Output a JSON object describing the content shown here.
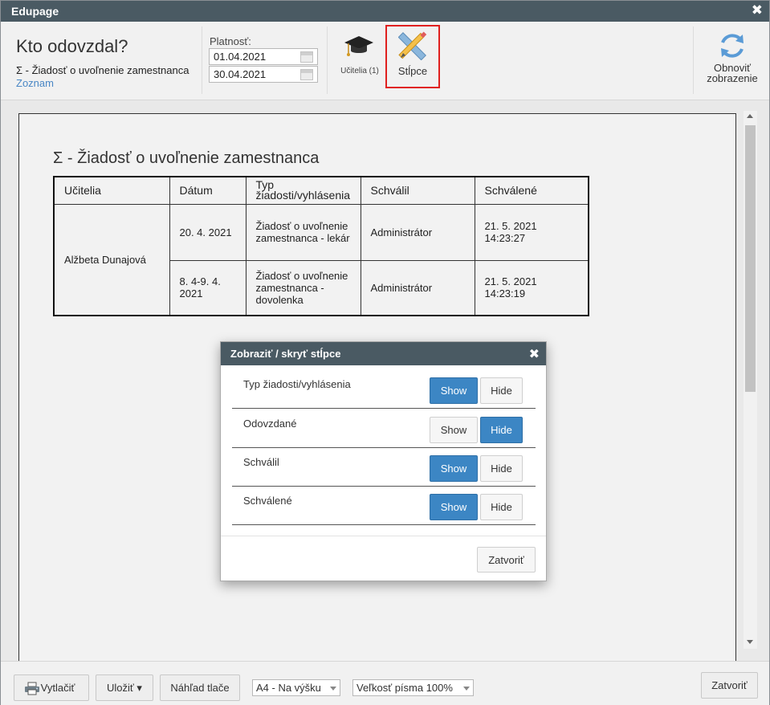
{
  "window": {
    "title": "Edupage",
    "close_glyph": "✖"
  },
  "header": {
    "title": "Kto odovzdal?",
    "subtitle": "Σ - Žiadosť o uvoľnenie zamestnanca",
    "link": "Zoznam",
    "validity_label": "Platnosť:",
    "date_from": "01.04.2021",
    "date_to": "30.04.2021",
    "teachers_label": "Učitelia (1)",
    "columns_label": "Stĺpce",
    "refresh_label_1": "Obnoviť",
    "refresh_label_2": "zobrazenie"
  },
  "report": {
    "title": "Σ - Žiadosť o uvoľnenie zamestnanca",
    "headers": [
      "Učitelia",
      "Dátum",
      "Typ žiadosti/vyhlásenia",
      "Schválil",
      "Schválené"
    ],
    "header_type_line1": "Typ",
    "header_type_line2": "žiadosti/vyhlásenia",
    "teacher": "Alžbeta Dunajová",
    "rows": [
      {
        "date": "20. 4. 2021",
        "type": "Žiadosť o uvoľnenie zamestnanca - lekár",
        "approver": "Administrátor",
        "approved": "21. 5. 2021 14:23:27"
      },
      {
        "date": "8. 4-9. 4. 2021",
        "type": "Žiadosť o uvoľnenie zamestnanca - dovolenka",
        "approver": "Administrátor",
        "approved": "21. 5. 2021 14:23:19"
      }
    ]
  },
  "dialog": {
    "title": "Zobraziť / skryť stĺpce",
    "close_glyph": "✖",
    "show_label": "Show",
    "hide_label": "Hide",
    "rows": [
      {
        "label": "Typ žiadosti/vyhlásenia",
        "shown": true
      },
      {
        "label": "Odovzdané",
        "shown": false
      },
      {
        "label": "Schválil",
        "shown": true
      },
      {
        "label": "Schválené",
        "shown": true
      }
    ],
    "close_button": "Zatvoriť"
  },
  "footer": {
    "print": "Vytlačiť",
    "save": "Uložiť ▾",
    "preview": "Náhľad tlače",
    "page_format": "A4 - Na výšku",
    "font_size": "Veľkosť písma 100%",
    "close": "Zatvoriť"
  },
  "colors": {
    "titlebar": "#4a5a63",
    "accent": "#3c86c4",
    "highlight_border": "#e0201f",
    "link": "#4a87c5"
  }
}
